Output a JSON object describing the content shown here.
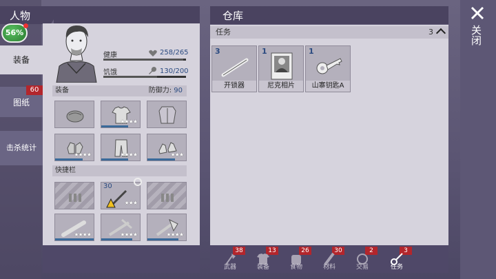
{
  "character": {
    "title": "人物",
    "percent": "56%",
    "tabs": [
      {
        "label": "装备",
        "badge": ""
      },
      {
        "label": "图纸",
        "badge": "60"
      },
      {
        "label": "击杀统计",
        "badge": ""
      }
    ],
    "stats": {
      "health_label": "健康",
      "health_value": "258/265",
      "health_ratio": 0.97,
      "hunger_label": "饥饿",
      "hunger_value": "130/200",
      "hunger_ratio": 0.65
    },
    "equip_label": "装备",
    "defense_label": "防御力:",
    "defense_value": "90",
    "quickbar_label": "快捷栏",
    "quick_count": "30",
    "equipment_icons": [
      "cap-icon",
      "shirt-icon",
      "coat-icon",
      "gloves-icon",
      "pants-icon",
      "shoes-icon"
    ],
    "quick_icons": [
      "empty",
      "screwdriver-icon",
      "empty",
      "baseball-bat-icon",
      "crossbow-icon",
      "axe-icon"
    ]
  },
  "warehouse": {
    "title": "仓库",
    "category_label": "任务",
    "category_count": "3",
    "items": [
      {
        "qty": "3",
        "name": "开锁器",
        "icon": "lockpick-icon"
      },
      {
        "qty": "1",
        "name": "尼克相片",
        "icon": "photo-icon"
      },
      {
        "qty": "1",
        "name": "山寨钥匙A",
        "icon": "key-icon"
      }
    ],
    "tabs": [
      {
        "label": "武器",
        "badge": "38",
        "icon": "axe-icon"
      },
      {
        "label": "装备",
        "badge": "13",
        "icon": "shirt-icon"
      },
      {
        "label": "食物",
        "badge": "26",
        "icon": "food-icon"
      },
      {
        "label": "材料",
        "badge": "30",
        "icon": "material-icon"
      },
      {
        "label": "交易",
        "badge": "2",
        "icon": "trade-icon"
      },
      {
        "label": "任务",
        "badge": "3",
        "icon": "task-key-icon"
      }
    ]
  },
  "close": {
    "label": "关闭"
  }
}
